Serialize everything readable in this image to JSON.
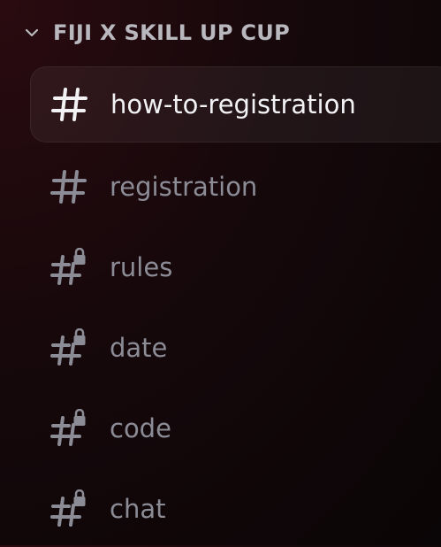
{
  "category": {
    "name": "FIJI X SKILL UP CUP",
    "icon": "chevron-down-icon"
  },
  "channels": [
    {
      "name": "how-to-registration",
      "icon": "text-channel-icon",
      "locked": false,
      "selected": true
    },
    {
      "name": "registration",
      "icon": "text-channel-icon",
      "locked": false,
      "selected": false
    },
    {
      "name": "rules",
      "icon": "locked-text-channel-icon",
      "locked": true,
      "selected": false
    },
    {
      "name": "date",
      "icon": "locked-text-channel-icon",
      "locked": true,
      "selected": false
    },
    {
      "name": "code",
      "icon": "locked-text-channel-icon",
      "locked": true,
      "selected": false
    },
    {
      "name": "chat",
      "icon": "locked-text-channel-icon",
      "locked": true,
      "selected": false
    }
  ],
  "colors": {
    "selected_text": "#f2f2f5",
    "muted_text": "#8c8c96",
    "category_text": "#b8b8be"
  }
}
